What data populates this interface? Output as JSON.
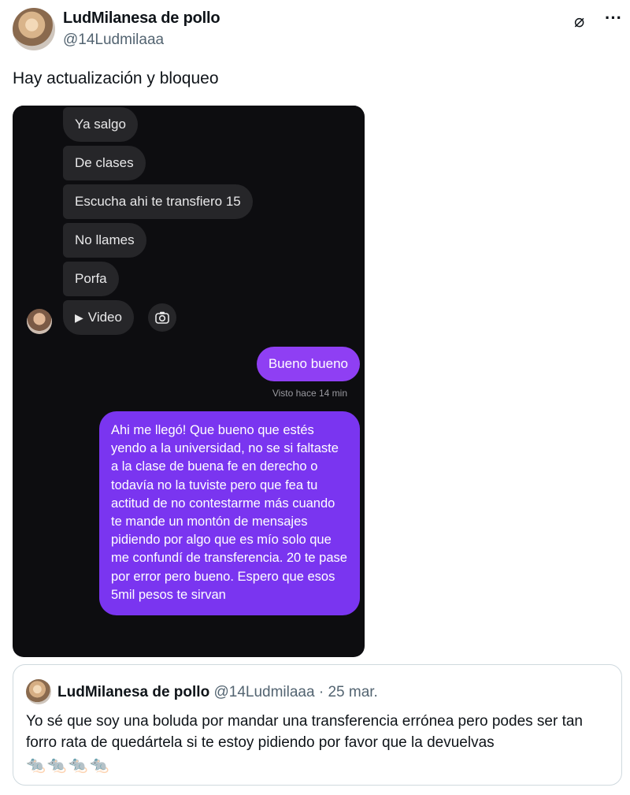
{
  "author": {
    "name": "LudMilanesa de pollo",
    "handle": "@14Ludmilaaa"
  },
  "header_icons": {
    "grok": "⌀",
    "more": "···"
  },
  "tweet": {
    "text": "Hay actualización y bloqueo"
  },
  "screenshot": {
    "received": [
      "Ya salgo",
      "De clases",
      "Escucha ahi te transfiero 15",
      "No llames",
      "Porfa"
    ],
    "video_label": "Video",
    "sent_short": "Bueno bueno",
    "seen_label": "Visto hace 14 min",
    "sent_long": "Ahi me llegó! Que bueno que estés yendo a la universidad, no se si faltaste a la clase de buena fe en derecho o todavía no la tuviste pero que fea tu actitud de no contestarme más cuando te mande un montón de mensajes pidiendo por algo que es mío solo que me confundí de transferencia. 20 te pase por error pero bueno. Espero que esos 5mil pesos te sirvan"
  },
  "quote": {
    "name": "LudMilanesa de pollo",
    "handle": "@14Ludmilaaa",
    "separator": "·",
    "date": "25 mar.",
    "text": "Yo sé que soy una boluda por mandar una transferencia errónea pero podes ser tan forro rata de quedártela si te estoy pidiendo por favor que la devuelvas",
    "emoji": "🐀🐀🐀🐀"
  }
}
